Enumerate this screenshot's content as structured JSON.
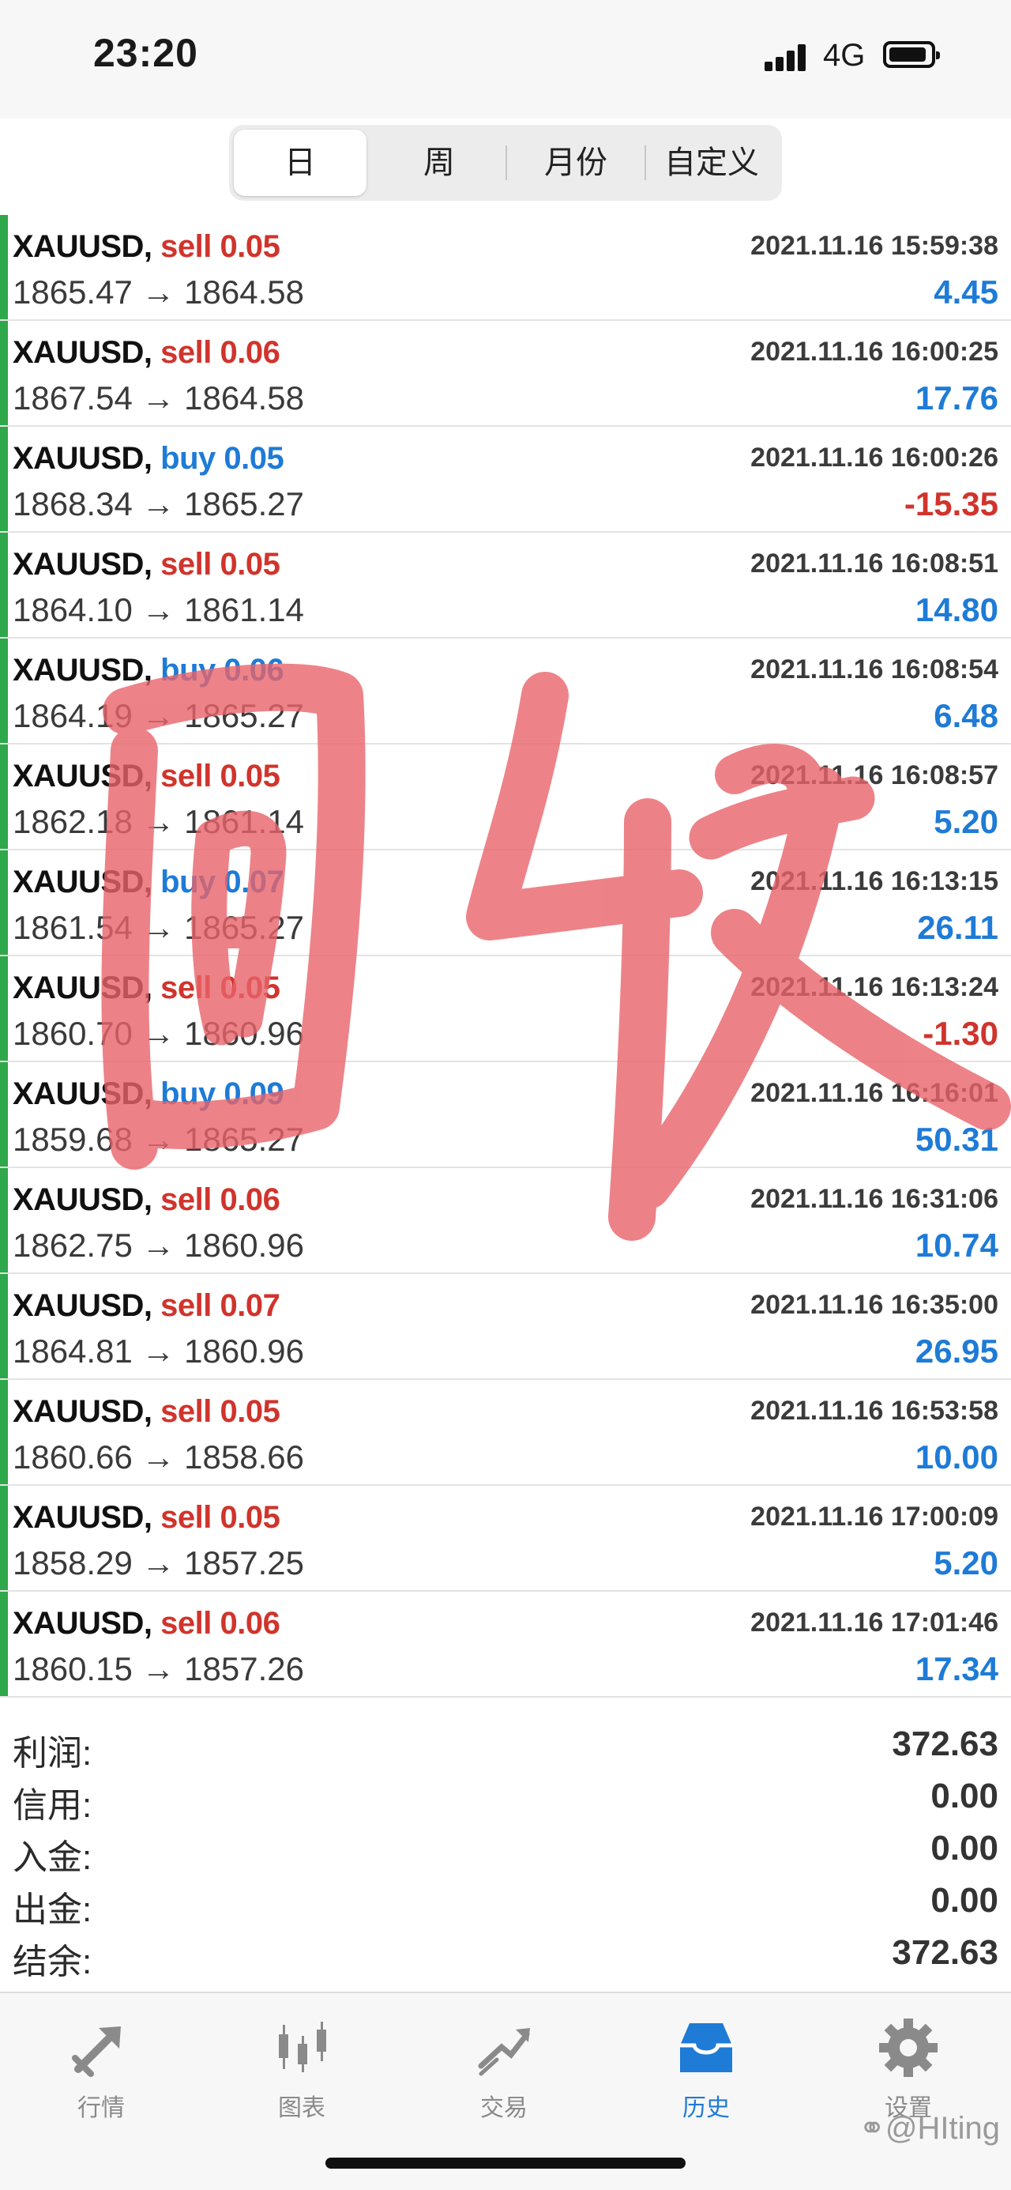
{
  "status_bar": {
    "time": "23:20",
    "network": "4G"
  },
  "segments": [
    {
      "label": "日",
      "active": true
    },
    {
      "label": "周",
      "active": false
    },
    {
      "label": "月份",
      "active": false
    },
    {
      "label": "自定义",
      "active": false
    }
  ],
  "trades": [
    {
      "symbol": "XAUUSD,",
      "side": "sell 0.05",
      "time": "2021.11.16 15:59:38",
      "prices": "1865.47 → 1864.58",
      "profit": "4.45"
    },
    {
      "symbol": "XAUUSD,",
      "side": "sell 0.06",
      "time": "2021.11.16 16:00:25",
      "prices": "1867.54 → 1864.58",
      "profit": "17.76"
    },
    {
      "symbol": "XAUUSD,",
      "side": "buy 0.05",
      "time": "2021.11.16 16:00:26",
      "prices": "1868.34 → 1865.27",
      "profit": "-15.35"
    },
    {
      "symbol": "XAUUSD,",
      "side": "sell 0.05",
      "time": "2021.11.16 16:08:51",
      "prices": "1864.10 → 1861.14",
      "profit": "14.80"
    },
    {
      "symbol": "XAUUSD,",
      "side": "buy 0.06",
      "time": "2021.11.16 16:08:54",
      "prices": "1864.19 → 1865.27",
      "profit": "6.48"
    },
    {
      "symbol": "XAUUSD,",
      "side": "sell 0.05",
      "time": "2021.11.16 16:08:57",
      "prices": "1862.18 → 1861.14",
      "profit": "5.20"
    },
    {
      "symbol": "XAUUSD,",
      "side": "buy 0.07",
      "time": "2021.11.16 16:13:15",
      "prices": "1861.54 → 1865.27",
      "profit": "26.11"
    },
    {
      "symbol": "XAUUSD,",
      "side": "sell 0.05",
      "time": "2021.11.16 16:13:24",
      "prices": "1860.70 → 1860.96",
      "profit": "-1.30"
    },
    {
      "symbol": "XAUUSD,",
      "side": "buy 0.09",
      "time": "2021.11.16 16:16:01",
      "prices": "1859.68 → 1865.27",
      "profit": "50.31"
    },
    {
      "symbol": "XAUUSD,",
      "side": "sell 0.06",
      "time": "2021.11.16 16:31:06",
      "prices": "1862.75 → 1860.96",
      "profit": "10.74"
    },
    {
      "symbol": "XAUUSD,",
      "side": "sell 0.07",
      "time": "2021.11.16 16:35:00",
      "prices": "1864.81 → 1860.96",
      "profit": "26.95"
    },
    {
      "symbol": "XAUUSD,",
      "side": "sell 0.05",
      "time": "2021.11.16 16:53:58",
      "prices": "1860.66 → 1858.66",
      "profit": "10.00"
    },
    {
      "symbol": "XAUUSD,",
      "side": "sell 0.05",
      "time": "2021.11.16 17:00:09",
      "prices": "1858.29 → 1857.25",
      "profit": "5.20"
    },
    {
      "symbol": "XAUUSD,",
      "side": "sell 0.06",
      "time": "2021.11.16 17:01:46",
      "prices": "1860.15 → 1857.26",
      "profit": "17.34"
    }
  ],
  "summary": [
    {
      "label": "利润:",
      "value": "372.63"
    },
    {
      "label": "信用:",
      "value": "0.00"
    },
    {
      "label": "入金:",
      "value": "0.00"
    },
    {
      "label": "出金:",
      "value": "0.00"
    },
    {
      "label": "结余:",
      "value": "372.63"
    }
  ],
  "tabs": [
    {
      "label": "行情",
      "icon": "quotes-icon",
      "active": false
    },
    {
      "label": "图表",
      "icon": "chart-icon",
      "active": false
    },
    {
      "label": "交易",
      "icon": "trade-icon",
      "active": false
    },
    {
      "label": "历史",
      "icon": "history-icon",
      "active": true
    },
    {
      "label": "设置",
      "icon": "settings-icon",
      "active": false
    }
  ],
  "overlay_text": "回收",
  "watermark": "@HIting",
  "colors": {
    "sell": "#d0342c",
    "buy": "#1e7bd6",
    "profit_pos": "#1e7bd6",
    "profit_neg": "#d0342c",
    "row_bar": "#2ea84a",
    "overlay": "#e8646a",
    "tab_active": "#1e7bd6",
    "tab_inactive": "#8a8a8a"
  }
}
